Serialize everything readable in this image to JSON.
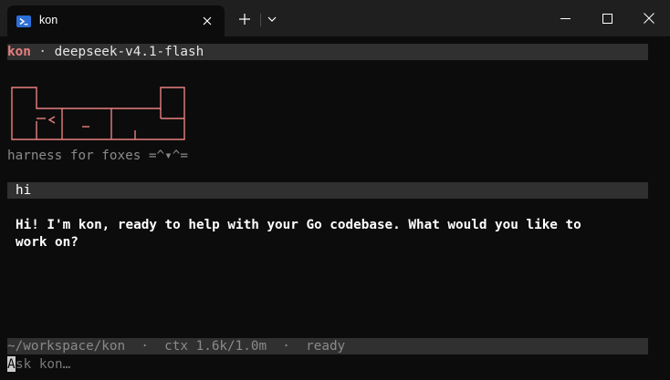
{
  "tab": {
    "title": "kon",
    "icon": "powershell-icon"
  },
  "window_controls": [
    "minimize-icon",
    "maximize-icon",
    "close-icon"
  ],
  "header": {
    "app_name": "kon",
    "separator": " · ",
    "model": "deepseek-v4.1-flash"
  },
  "logo": {
    "description_icon": "kon-ascii-logo",
    "color": "#e8807f"
  },
  "tagline": "harness for foxes =^▾^=",
  "conversation": {
    "user_message": "hi",
    "assistant_message": "Hi! I'm kon, ready to help with your Go codebase. What would you like to\nwork on?"
  },
  "status": {
    "cwd": "~/workspace/kon",
    "separator": "  ·  ",
    "context": "ctx 1.6k/1.0m",
    "state": "ready"
  },
  "prompt": {
    "cursor_char": "A",
    "placeholder_rest": "sk kon…"
  },
  "colors": {
    "background": "#0c0c0c",
    "titlebar": "#1f1f1f",
    "accent": "#e8807f",
    "bar": "#303030"
  }
}
